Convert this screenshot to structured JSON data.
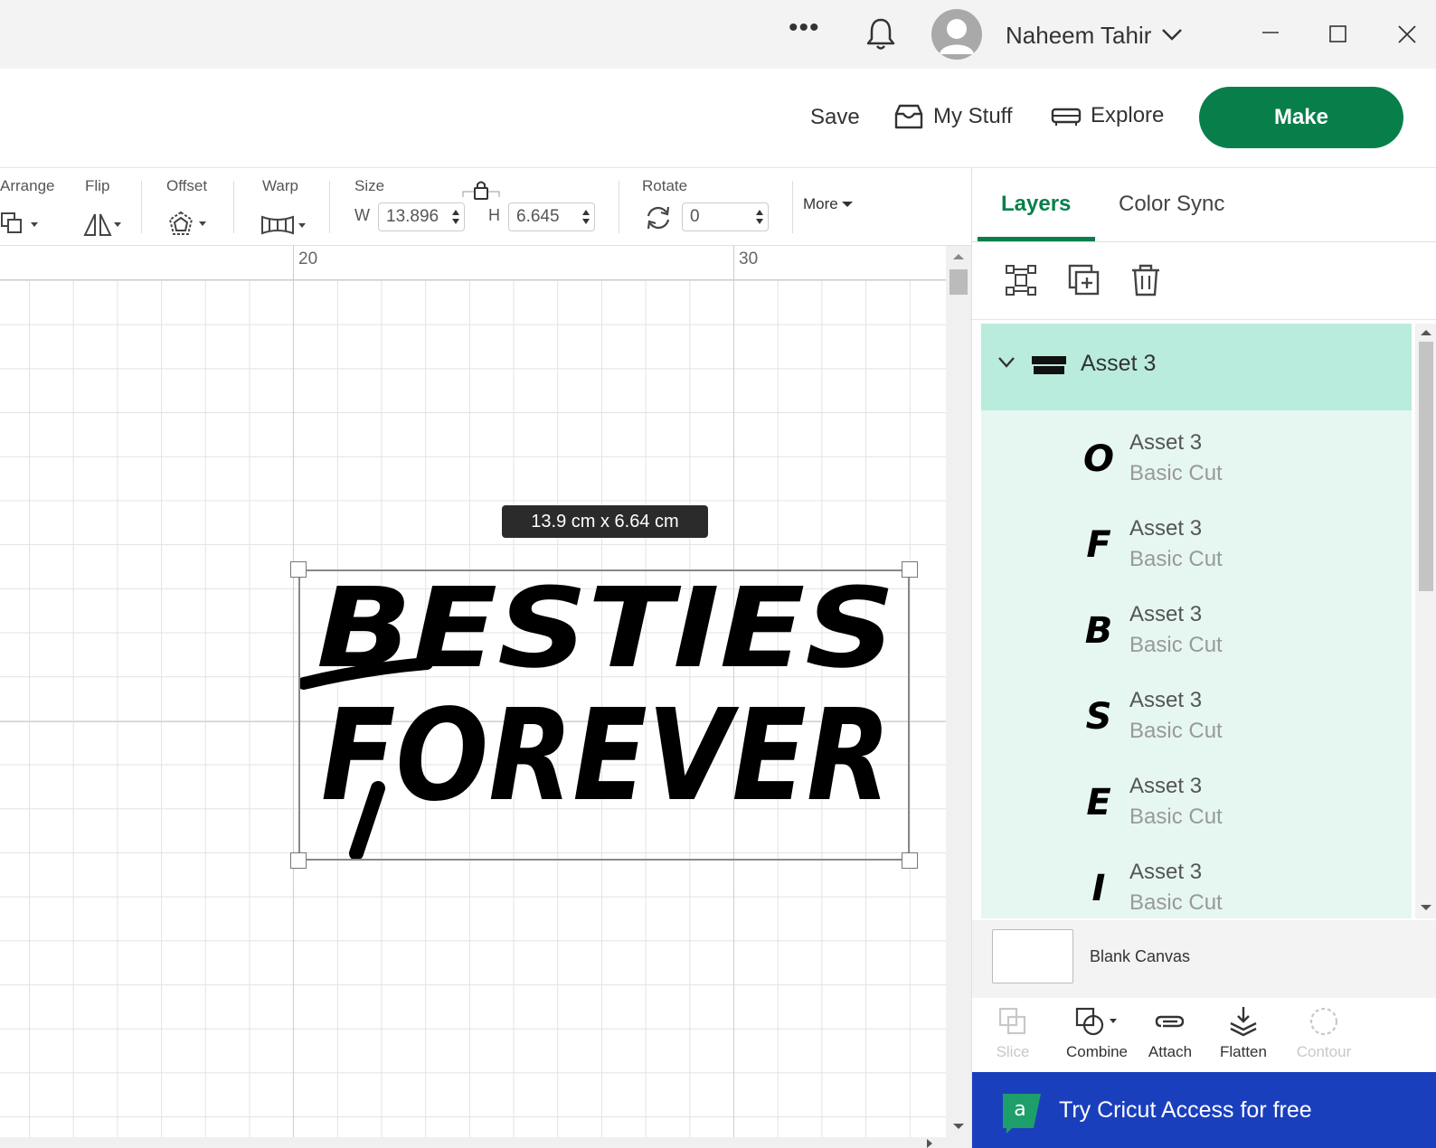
{
  "titlebar": {
    "more_label": "•••",
    "user_name": "Naheem Tahir"
  },
  "header": {
    "save_label": "Save",
    "mystuff_label": "My Stuff",
    "explore_label": "Explore",
    "make_label": "Make",
    "accent_color": "#087f4b"
  },
  "toolbar": {
    "arrange_label": "Arrange",
    "flip_label": "Flip",
    "offset_label": "Offset",
    "warp_label": "Warp",
    "size_label": "Size",
    "w_label": "W",
    "w_value": "13.896",
    "h_label": "H",
    "h_value": "6.645",
    "rotate_label": "Rotate",
    "rotate_value": "0",
    "more_label": "More"
  },
  "canvas": {
    "ruler_marks": [
      "20",
      "30"
    ],
    "size_tooltip": "13.9  cm x 6.64  cm",
    "artwork_line1": "BESTIES",
    "artwork_line2": "FOREVER"
  },
  "panel": {
    "tabs": [
      {
        "label": "Layers",
        "active": true
      },
      {
        "label": "Color Sync",
        "active": false
      }
    ],
    "group": {
      "name": "Asset 3",
      "thumb_text": "BESTIES FOREVER"
    },
    "layers": [
      {
        "glyph": "O",
        "name": "Asset 3",
        "type": "Basic Cut"
      },
      {
        "glyph": "F",
        "name": "Asset 3",
        "type": "Basic Cut"
      },
      {
        "glyph": "B",
        "name": "Asset 3",
        "type": "Basic Cut"
      },
      {
        "glyph": "S",
        "name": "Asset 3",
        "type": "Basic Cut"
      },
      {
        "glyph": "E",
        "name": "Asset 3",
        "type": "Basic Cut"
      },
      {
        "glyph": "I",
        "name": "Asset 3",
        "type": "Basic Cut"
      }
    ],
    "blank_canvas_label": "Blank Canvas",
    "tools": {
      "slice": "Slice",
      "combine": "Combine",
      "attach": "Attach",
      "flatten": "Flatten",
      "contour": "Contour"
    },
    "promo_label": "Try Cricut Access for free",
    "promo_color": "#1a3fbd"
  }
}
